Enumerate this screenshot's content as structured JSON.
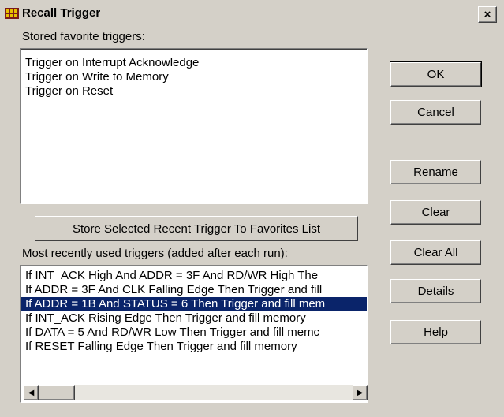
{
  "window": {
    "title": "Recall Trigger",
    "close_glyph": "×"
  },
  "favorites": {
    "label": "Stored favorite triggers:",
    "items": [
      "Trigger on Interrupt Acknowledge",
      "Trigger on Write to Memory",
      "Trigger on Reset"
    ]
  },
  "store_button_label": "Store Selected Recent Trigger To Favorites List",
  "recent": {
    "label": "Most recently used triggers (added after each run):",
    "selected_index": 2,
    "items": [
      "If INT_ACK High And ADDR = 3F And RD/WR High The",
      "If ADDR = 3F And CLK Falling Edge Then Trigger and fill",
      "If ADDR = 1B And STATUS = 6 Then Trigger and fill mem",
      "If INT_ACK Rising Edge Then Trigger and fill memory",
      "If DATA = 5 And RD/WR Low Then Trigger and fill memc",
      "If RESET Falling Edge Then Trigger and fill memory"
    ]
  },
  "buttons": {
    "ok": "OK",
    "cancel": "Cancel",
    "rename": "Rename",
    "clear": "Clear",
    "clear_all": "Clear All",
    "details": "Details",
    "help": "Help"
  },
  "scrollbar": {
    "left_arrow": "◀",
    "right_arrow": "▶"
  },
  "colors": {
    "face": "#d4d0c8",
    "selection": "#0a246a"
  }
}
